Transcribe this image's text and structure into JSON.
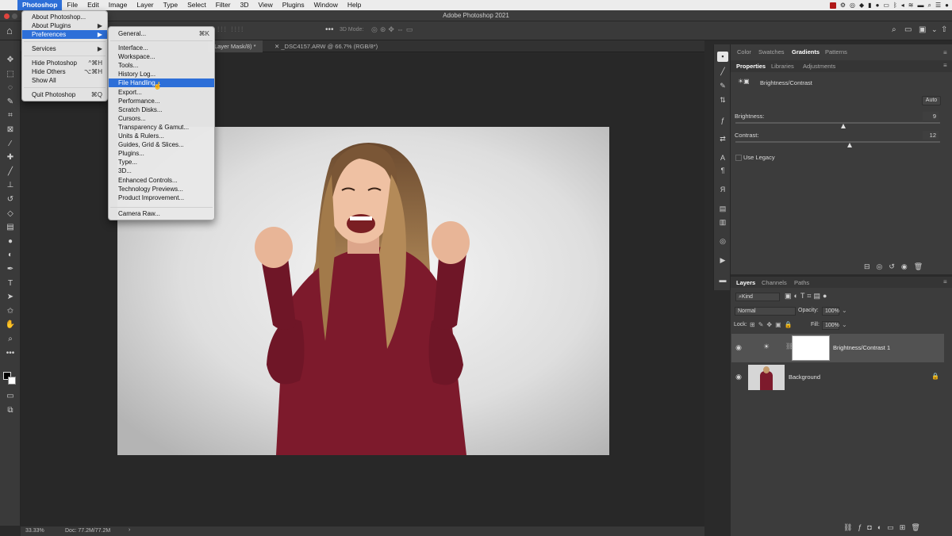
{
  "menubar": {
    "apple": "",
    "items": [
      "Photoshop",
      "File",
      "Edit",
      "Image",
      "Layer",
      "Type",
      "Select",
      "Filter",
      "3D",
      "View",
      "Plugins",
      "Window",
      "Help"
    ]
  },
  "window": {
    "title": "Adobe Photoshop 2021"
  },
  "tabs": {
    "active": "Layer Mask/8) *",
    "second": "_DSC4157.ARW @ 66.7% (RGB/8*)"
  },
  "options": {
    "mode_3d": "3D Mode:"
  },
  "app_menu": {
    "about": "About Photoshop...",
    "about_plugins": "About Plugins",
    "preferences": "Preferences",
    "services": "Services",
    "hide": "Hide Photoshop",
    "hide_shortcut": "^⌘H",
    "hide_others": "Hide Others",
    "hide_others_shortcut": "⌥⌘H",
    "show_all": "Show All",
    "quit": "Quit Photoshop",
    "quit_shortcut": "⌘Q"
  },
  "prefs_menu": {
    "general": "General...",
    "general_shortcut": "⌘K",
    "items": [
      "Interface...",
      "Workspace...",
      "Tools...",
      "History Log...",
      "File Handling...",
      "Export...",
      "Performance...",
      "Scratch Disks...",
      "Cursors...",
      "Transparency & Gamut...",
      "Units & Rulers...",
      "Guides, Grid & Slices...",
      "Plugins...",
      "Type...",
      "3D...",
      "Enhanced Controls...",
      "Technology Previews...",
      "Product Improvement..."
    ],
    "highlighted_index": 4,
    "camera_raw": "Camera Raw..."
  },
  "status": {
    "zoom": "33.33%",
    "doc": "Doc: 77.2M/77.2M",
    "arrow": "›"
  },
  "panels": {
    "top_tabs": [
      "Color",
      "Swatches",
      "Gradients",
      "Patterns"
    ],
    "top_active": "Gradients",
    "sub_tabs": [
      "Properties",
      "Libraries",
      "Adjustments"
    ],
    "sub_active": "Properties",
    "adjustment_name": "Brightness/Contrast",
    "auto": "Auto",
    "brightness_label": "Brightness:",
    "brightness_value": "9",
    "contrast_label": "Contrast:",
    "contrast_value": "12",
    "use_legacy": "Use Legacy"
  },
  "layers": {
    "tabs": [
      "Layers",
      "Channels",
      "Paths"
    ],
    "active_tab": "Layers",
    "kind": "Kind",
    "blend": "Normal",
    "opacity_label": "Opacity:",
    "opacity": "100%",
    "lock_label": "Lock:",
    "fill_label": "Fill:",
    "fill": "100%",
    "rows": [
      {
        "name": "Brightness/Contrast 1"
      },
      {
        "name": "Background"
      }
    ]
  },
  "colors": {
    "accent": "#2d6fd8",
    "sweater": "#7d1a2c"
  }
}
